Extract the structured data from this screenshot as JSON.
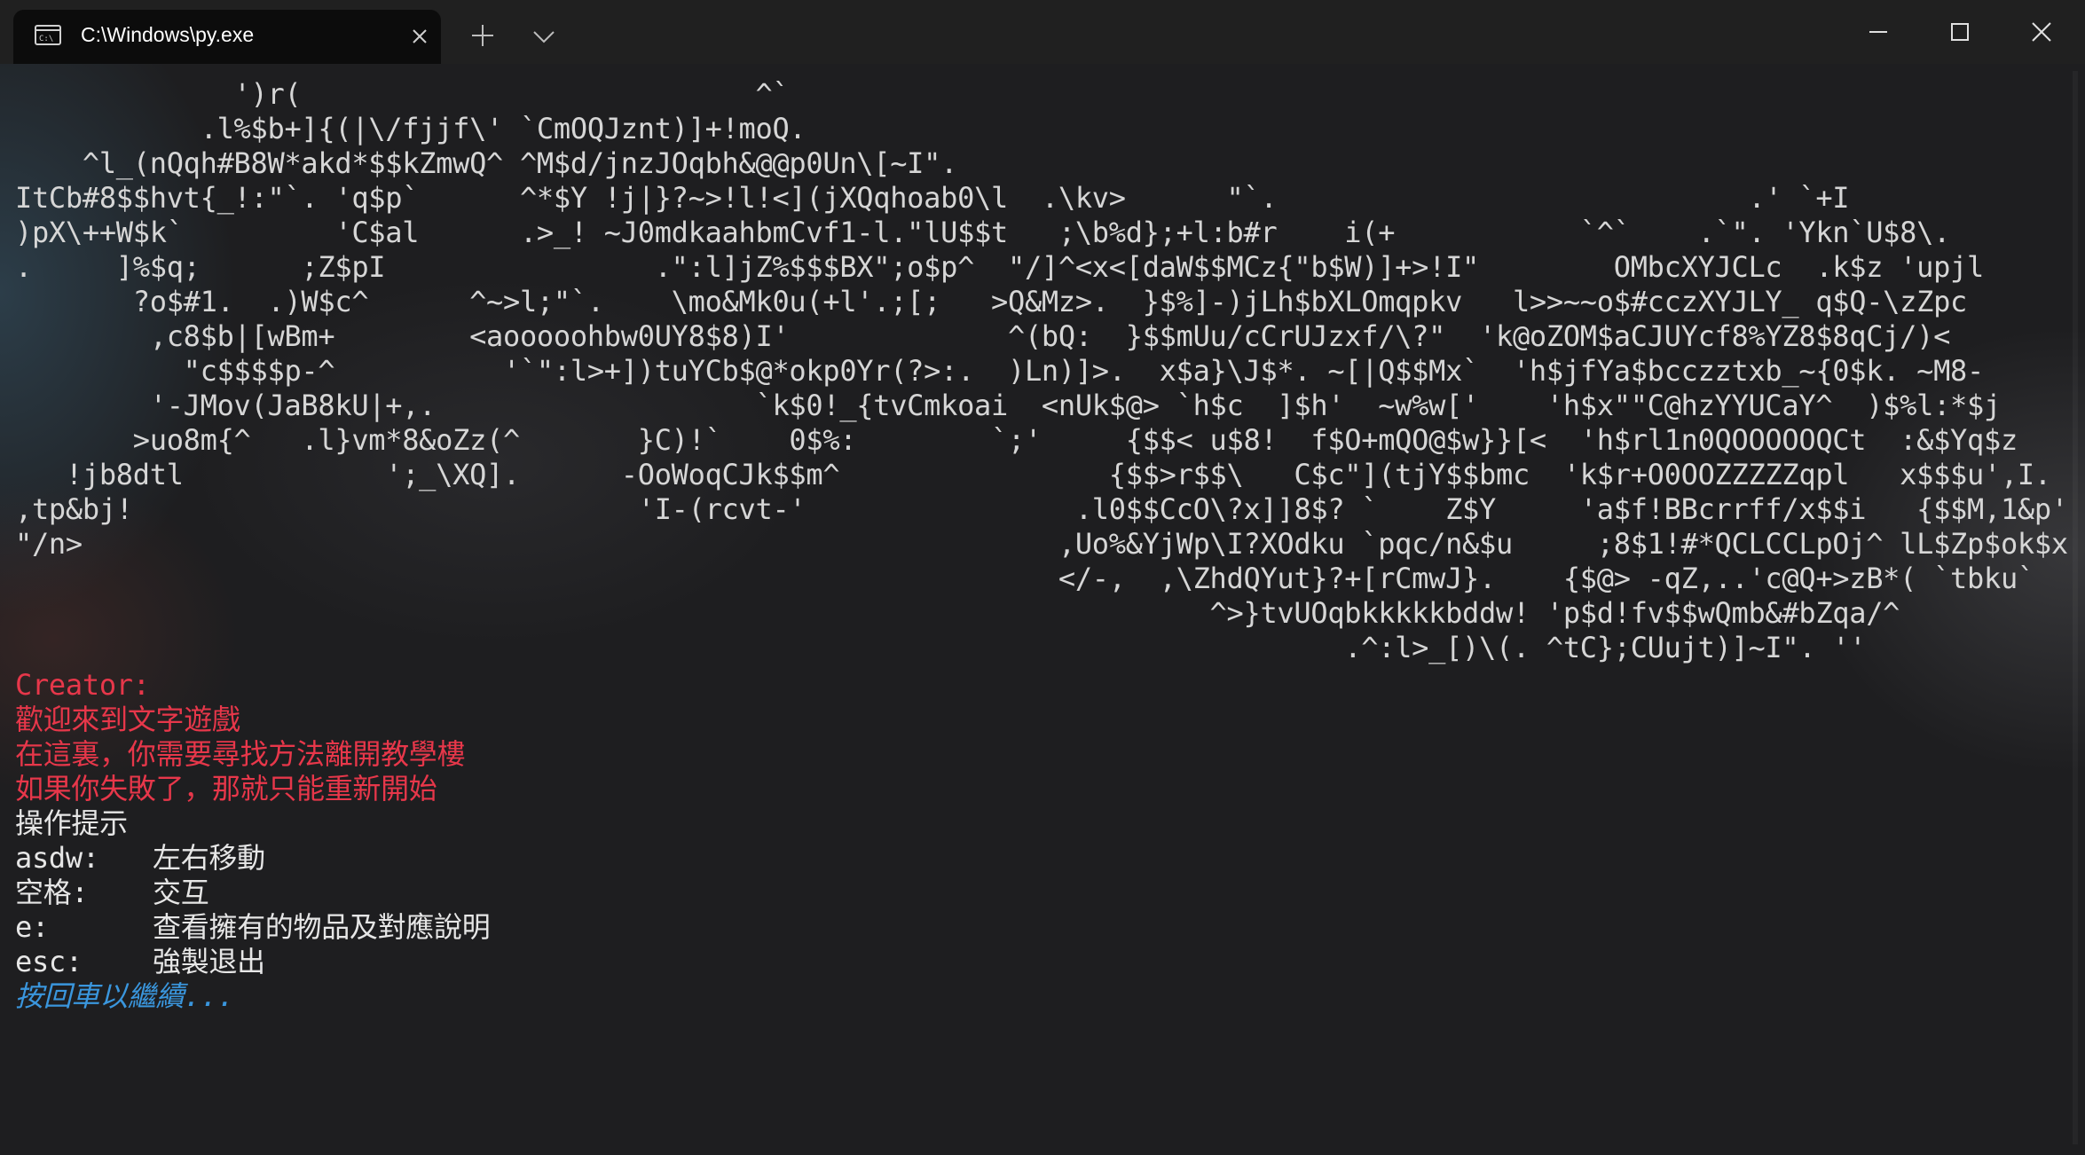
{
  "window": {
    "tab_title": "C:\\Windows\\py.exe",
    "tab_icon": "terminal-icon",
    "colors": {
      "red": "#e7374a",
      "blue": "#3a96dd",
      "text": "#d6d6d6",
      "background": "#1e1e20",
      "tab_background": "#0c0c0c"
    }
  },
  "ascii_art": [
    "             ')r(                           ^`",
    "           .l%$b+]{(|\\/fjjf\\' `CmOQJznt)]+!moQ.",
    "    ^l_(nQqh#B8W*akd*$$kZmwQ^ ^M$d/jnzJOqbh&@@p0Un\\[~I\".",
    "ItCb#8$$hvt{_!:\"`. 'q$p`      ^*$Y !j|}?~>!l!<](jXQqhoab0\\l  .\\kv>      \"`.                            .' `+I",
    ")pX\\++W$k`         'C$al      .>_! ~J0mdkaahbmCvf1-l.\"lU$$t   ;\\b%d};+l:b#r    i(+           `^`    .`\". 'Ykn`U$8\\.",
    ".     ]%$q;      ;Z$pI                .\":l]jZ%$$$BX\";o$p^  \"/]^<x<[daW$$MCz{\"b$W)]+>!I\"        OMbcXYJCLc  .k$z 'upjl",
    "       ?o$#1.  .)W$c^      ^~>l;\"`.    \\mo&Mk0u(+l'.;[;   >Q&Mz>.  }$%]-)jLh$bXLOmqpkv   l>>~~o$#cczXYJLY_ q$Q-\\zZpc",
    "        ,c8$b|[wBm+        <aooooohbw0UY8$8)I'             ^(bQ:  }$$mUu/cCrUJzxf/\\?\"  'k@oZOM$aCJUYcf8%YZ8$8qCj/)<",
    "          \"c$$$$p-^          '`\":l>+])tuYCb$@*okp0Yr(?>:.  )Ln)]>.  x$a}\\J$*. ~[|Q$$Mx`  'h$jfYa$bcczztxb_~{0$k. ~M8-",
    "        '-JMov(JaB8kU|+,.                   `k$0!_{tvCmkoai  <nUk$@> `h$c  ]$h'  ~w%w['    'h$x\"\"C@hzYYUCaY^  )$%l:*$j",
    "       >uo8m{^   .l}vm*8&oZz(^       }C)!`    0$%:        `;'     {$$< u$8!  f$O+mQO@$w}}[<  'h$rl1n0QOOOOOQCt  :&$Yq$z",
    "   !jb8dtl            ';_\\XQ].      -OoWoqCJk$$m^                {$$>r$$\\   C$c\"](tjY$$bmc  'k$r+O0OOZZZZZqpl   x$$$u',I.",
    ",tp&bj!                              'I-(rcvt-'                .l0$$CcO\\?x]]8$? `    Z$Y     'a$f!BBcrrff/x$$i   {$$M,1&p'",
    "\"/n>                                                          ,Uo%&YjWp\\I?XOdku `pqc/n&$u     ;8$1!#*QCLCCLpOj^ lL$Zp$ok$x",
    "                                                              </-,  ,\\ZhdQYut}?+[rCmwJ}.    {$@> -qZ,..'c@Q+>zB*( `tbku`",
    "                                                                       ^>}tvUOqbkkkkkbddw! 'p$d!fv$$wQmb&#bZqa/^",
    "                                                                               .^:l>_[)\\(. ^tC};CUujt)]~I\". ''"
  ],
  "game_text": {
    "creator_label": "Creator:",
    "red_lines": [
      "歡迎來到文字遊戲",
      "在這裏，你需要尋找方法離開教學樓",
      "如果你失敗了，那就只能重新開始"
    ],
    "hint_title": "操作提示",
    "controls": [
      {
        "key": "asdw:",
        "desc": "左右移動"
      },
      {
        "key": "空格:",
        "desc": "交互"
      },
      {
        "key": "e:",
        "desc": "查看擁有的物品及對應說明"
      },
      {
        "key": "esc:",
        "desc": "強製退出"
      }
    ],
    "prompt": "按回車以繼續..."
  }
}
